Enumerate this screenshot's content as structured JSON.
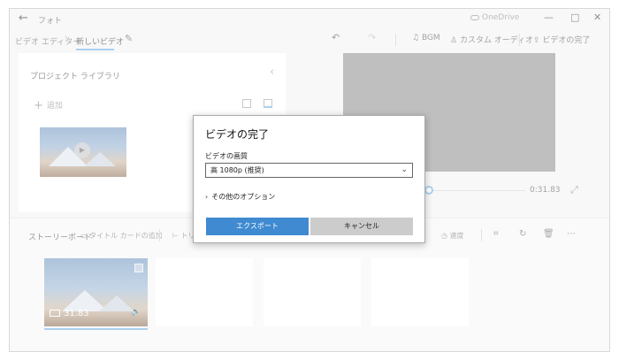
{
  "titlebar": {
    "title": "フォト",
    "onedrive": "OneDrive"
  },
  "toolbar": {
    "crumb_video_editor": "ビデオ エディター",
    "crumb_new_video": "新しいビデオ",
    "bgm": "BGM",
    "custom_audio": "カスタム オーディオ",
    "finish_video": "ビデオの完了"
  },
  "library": {
    "title": "プロジェクト ライブラリ",
    "add": "追加"
  },
  "preview": {
    "timecode": "0:31.83"
  },
  "storyboard": {
    "title": "ストーリーボード",
    "add_title_card": "タイトル カードの追加",
    "trim_partial": "トリ",
    "speed": "速度",
    "clip_duration": "31.83"
  },
  "dialog": {
    "title": "ビデオの完了",
    "quality_label": "ビデオの画質",
    "quality_value": "高 1080p (推奨)",
    "more_options": "その他のオプション",
    "export_button": "エクスポート",
    "cancel_button": "キャンセル"
  }
}
